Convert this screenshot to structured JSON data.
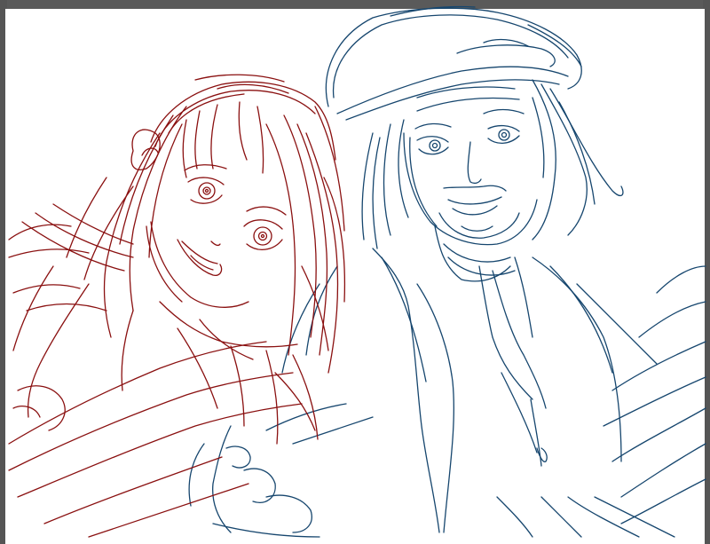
{
  "document": {
    "kind": "sketch-canvas"
  },
  "colors": {
    "background": "#ffffff",
    "workspace": "#4a4a4a",
    "red_stroke": "#8a1010",
    "blue_stroke": "#16466e"
  },
  "figures": [
    {
      "name": "girl-figure",
      "stroke_color": "#8a1010"
    },
    {
      "name": "man-figure",
      "stroke_color": "#16466e"
    }
  ]
}
